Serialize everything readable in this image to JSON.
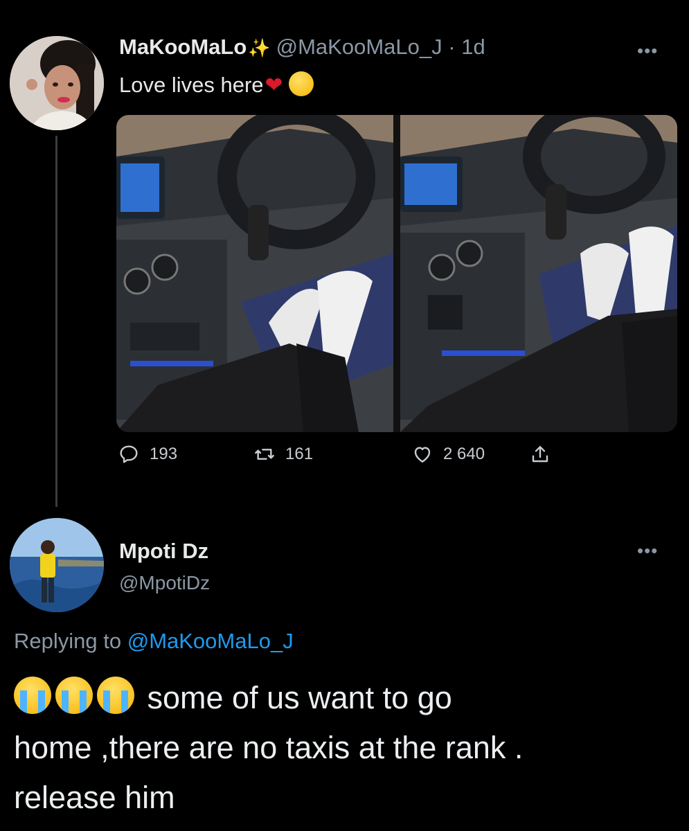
{
  "tweet": {
    "name": "MaKooMaLo",
    "handle": "@MaKooMaLo_J",
    "separator": "·",
    "time": "1d",
    "text": "Love lives here",
    "stats": {
      "replies": "193",
      "retweets": "161",
      "likes": "2 640"
    }
  },
  "reply": {
    "name": "Mpoti Dz",
    "handle": "@MpotiDz",
    "replying_prefix": "Replying to",
    "replying_handle": "@MaKooMaLo_J",
    "text_line1": "some of us want to go",
    "text_line2": "home ,there are no taxis at the rank .",
    "text_line3": "release him"
  },
  "icons": {
    "more": "more-options-icon",
    "reply": "reply-icon",
    "retweet": "retweet-icon",
    "like": "heart-icon",
    "share": "share-icon"
  },
  "colors": {
    "background": "#000000",
    "text": "#e7e9ea",
    "muted": "#8b98a5",
    "link": "#1d9bf0"
  }
}
